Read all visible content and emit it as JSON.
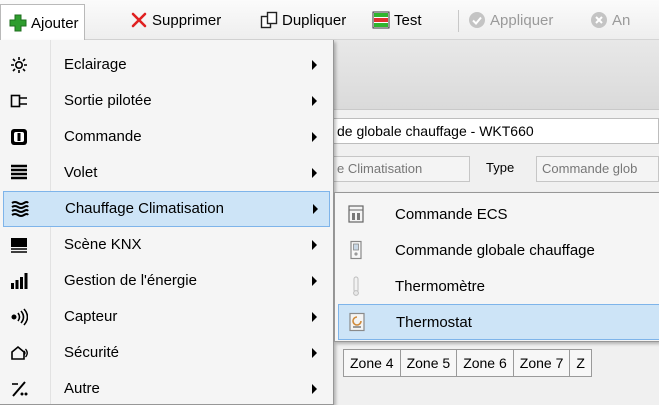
{
  "toolbar": {
    "add_label": "Ajouter",
    "delete_label": "Supprimer",
    "duplicate_label": "Dupliquer",
    "test_label": "Test",
    "apply_label": "Appliquer",
    "cancel_label": "An"
  },
  "background_form": {
    "title_value": "de globale chauffage - WKT660",
    "category_value": "e Climatisation",
    "type_label": "Type",
    "type_value": "Commande glob",
    "zone_tabs": [
      "Zone 4",
      "Zone 5",
      "Zone 6",
      "Zone 7",
      "Z"
    ]
  },
  "add_menu": {
    "items": [
      {
        "label": "Eclairage",
        "icon": "light-bulb-icon"
      },
      {
        "label": "Sortie pilotée",
        "icon": "output-icon"
      },
      {
        "label": "Commande",
        "icon": "switch-icon"
      },
      {
        "label": "Volet",
        "icon": "shutter-icon"
      },
      {
        "label": "Chauffage Climatisation",
        "icon": "heating-icon",
        "highlighted": true
      },
      {
        "label": "Scène KNX",
        "icon": "scene-icon"
      },
      {
        "label": "Gestion de l'énergie",
        "icon": "energy-bars-icon"
      },
      {
        "label": "Capteur",
        "icon": "sensor-icon"
      },
      {
        "label": "Sécurité",
        "icon": "security-icon"
      },
      {
        "label": "Autre",
        "icon": "other-icon"
      }
    ]
  },
  "heating_submenu": {
    "items": [
      {
        "label": "Commande ECS",
        "icon": "ecs-icon"
      },
      {
        "label": "Commande globale chauffage",
        "icon": "global-heating-icon"
      },
      {
        "label": "Thermomètre",
        "icon": "thermometer-icon"
      },
      {
        "label": "Thermostat",
        "icon": "thermostat-icon",
        "highlighted": true
      }
    ]
  },
  "colors": {
    "highlight_bg": "#cde4f7",
    "highlight_border": "#7eb4ea",
    "add_green": "#2e9d2e",
    "delete_red": "#e02020"
  }
}
